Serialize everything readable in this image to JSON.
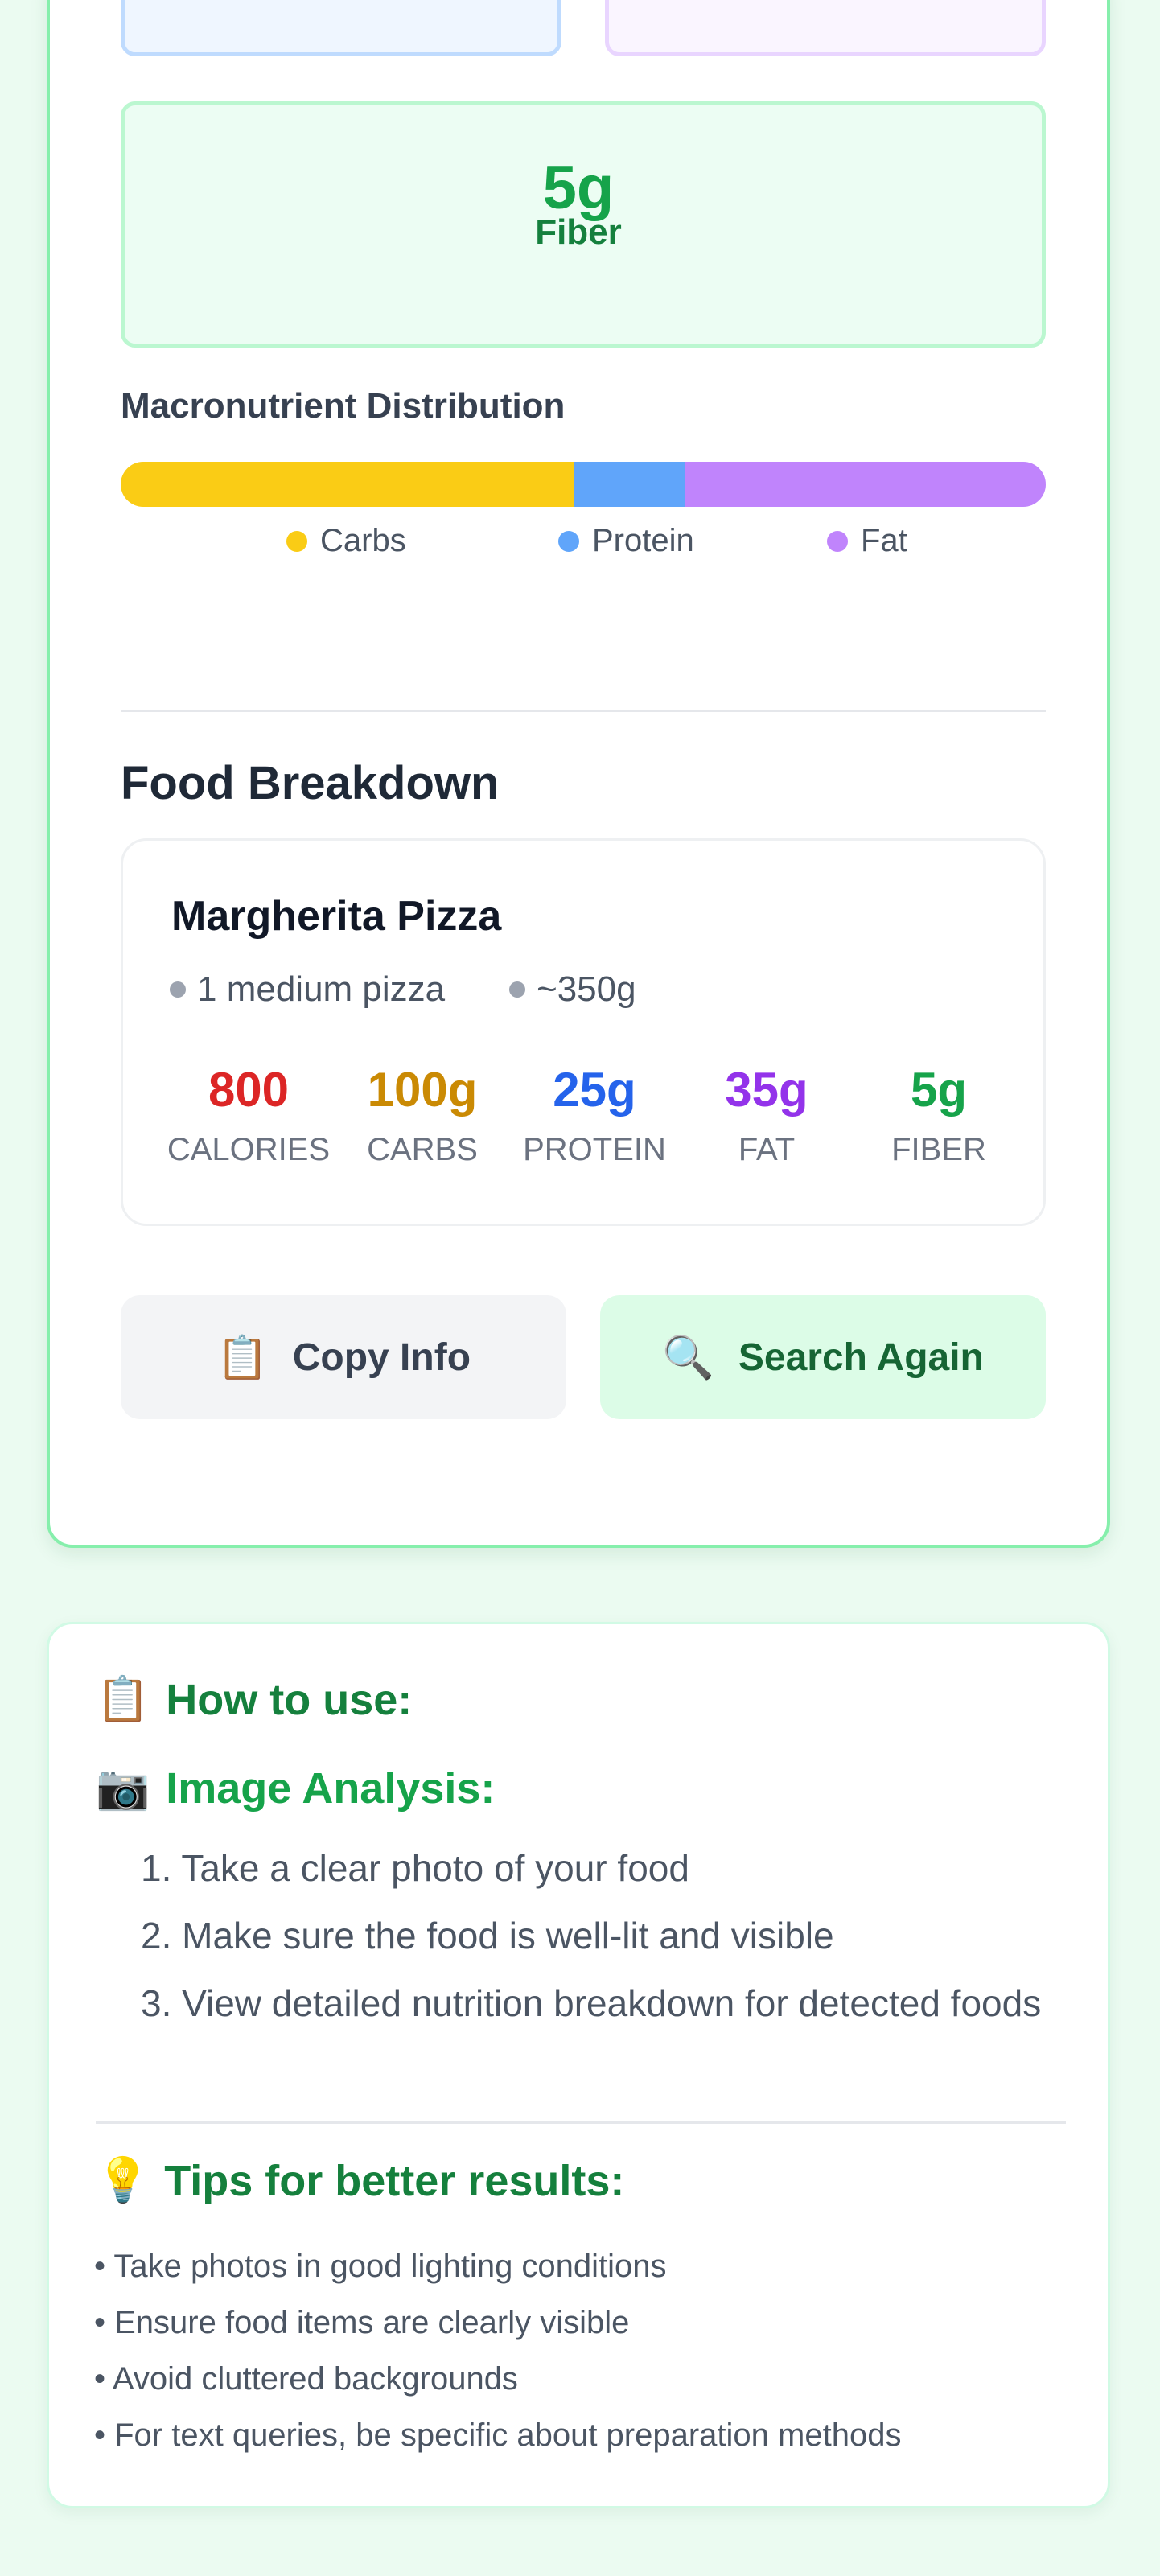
{
  "nutrition_summary": {
    "fiber": {
      "value": "5g",
      "label": "Fiber"
    }
  },
  "macro_distribution": {
    "title": "Macronutrient Distribution",
    "segments": [
      {
        "name": "Carbs",
        "fraction": 0.49,
        "color": "#facc15"
      },
      {
        "name": "Protein",
        "fraction": 0.12,
        "color": "#60a5fa"
      },
      {
        "name": "Fat",
        "fraction": 0.39,
        "color": "#c084fc"
      }
    ]
  },
  "breakdown": {
    "title": "Food Breakdown",
    "food": {
      "name": "Margherita Pizza",
      "portion": "1 medium pizza",
      "weight": "~350g",
      "stats": [
        {
          "value": "800",
          "label": "CALORIES",
          "color": "#dc2626"
        },
        {
          "value": "100g",
          "label": "CARBS",
          "color": "#ca8a04"
        },
        {
          "value": "25g",
          "label": "PROTEIN",
          "color": "#2563eb"
        },
        {
          "value": "35g",
          "label": "FAT",
          "color": "#9333ea"
        },
        {
          "value": "5g",
          "label": "FIBER",
          "color": "#16a34a"
        }
      ]
    }
  },
  "actions": {
    "copy": {
      "icon": "clipboard-icon",
      "glyph": "📋",
      "label": "Copy Info"
    },
    "search": {
      "icon": "magnifier-icon",
      "glyph": "🔍",
      "label": "Search Again"
    }
  },
  "help": {
    "title": {
      "glyph": "📋",
      "text": "How to use:"
    },
    "image_analysis": {
      "glyph": "📷",
      "text": "Image Analysis:"
    },
    "steps": [
      "1. Take a clear photo of your food",
      "2. Make sure the food is well-lit and visible",
      "3. View detailed nutrition breakdown for detected foods"
    ],
    "tips_title": {
      "glyph": "💡",
      "text": "Tips for better results:"
    },
    "tips": [
      "• Take photos in good lighting conditions",
      "• Ensure food items are clearly visible",
      "• Avoid cluttered backgrounds",
      "• For text queries, be specific about preparation methods"
    ]
  }
}
